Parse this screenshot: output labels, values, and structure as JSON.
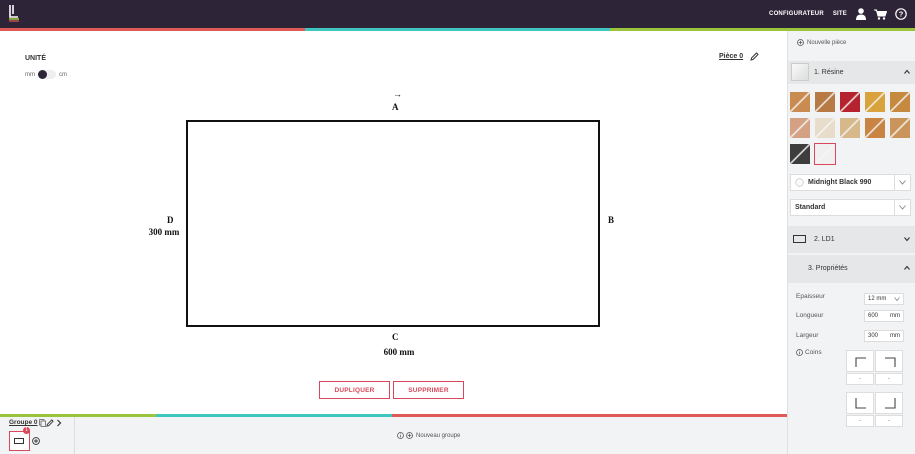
{
  "topbar": {
    "nav_configurateur": "CONFIGURATEUR",
    "nav_site": "SITE",
    "icons": [
      "user-icon",
      "cart-icon",
      "help-icon"
    ],
    "stripe_colors": [
      "#e05a57",
      "#3ec6c0",
      "#9ac43c"
    ]
  },
  "unit": {
    "title": "UNITÉ",
    "option_mm": "mm",
    "option_cm": "cm",
    "selected": "mm"
  },
  "piece": {
    "title": "Pièce 0"
  },
  "shape": {
    "side_a": "A",
    "side_b": "B",
    "side_c": "C",
    "side_d": "D",
    "length_label": "600 mm",
    "width_label": "300 mm"
  },
  "actions": {
    "duplicate": "DUPLIQUER",
    "delete": "SUPPRIMER"
  },
  "bottom": {
    "group_title": "Groupe 0",
    "group_count_badge": "1",
    "new_group": "Nouveau groupe"
  },
  "sidebar": {
    "new_piece": "Nouvelle pièce",
    "material_section": "1. Résine",
    "materials": [
      {
        "name": "wood-light",
        "color": "#c98b4f"
      },
      {
        "name": "wood-medium",
        "color": "#b77a45"
      },
      {
        "name": "red-pattern",
        "color": "#b5242e"
      },
      {
        "name": "wood-yellow",
        "color": "#d9a23c"
      },
      {
        "name": "wood-honey",
        "color": "#c58a3f"
      },
      {
        "name": "terracotta",
        "color": "#d4a185"
      },
      {
        "name": "light-beige",
        "color": "#e8dccb"
      },
      {
        "name": "wood-pale",
        "color": "#d7b88a"
      },
      {
        "name": "wood-orange",
        "color": "#c98444"
      },
      {
        "name": "wood-tan",
        "color": "#c9955a"
      },
      {
        "name": "dark-grey",
        "color": "#3d3d3d"
      },
      {
        "name": "white-gloss",
        "color": "#f0f0f0"
      }
    ],
    "selected_material_index": 11,
    "color_dropdown": "Midnight Black 990",
    "finish_dropdown": "Standard",
    "shape_section": "2. LD1",
    "properties_section": "3. Propriétés",
    "properties": {
      "epaisseur_label": "Epaisseur",
      "epaisseur_value": "12 mm",
      "longueur_label": "Longueur",
      "longueur_value": "600",
      "longueur_unit": "mm",
      "largeur_label": "Largeur",
      "largeur_value": "300",
      "largeur_unit": "mm",
      "coins_label": "Coins",
      "corner_values": [
        "-",
        "-",
        "-",
        "-"
      ]
    }
  },
  "colors": {
    "accent": "#d9475a",
    "dark": "#2e2438"
  }
}
